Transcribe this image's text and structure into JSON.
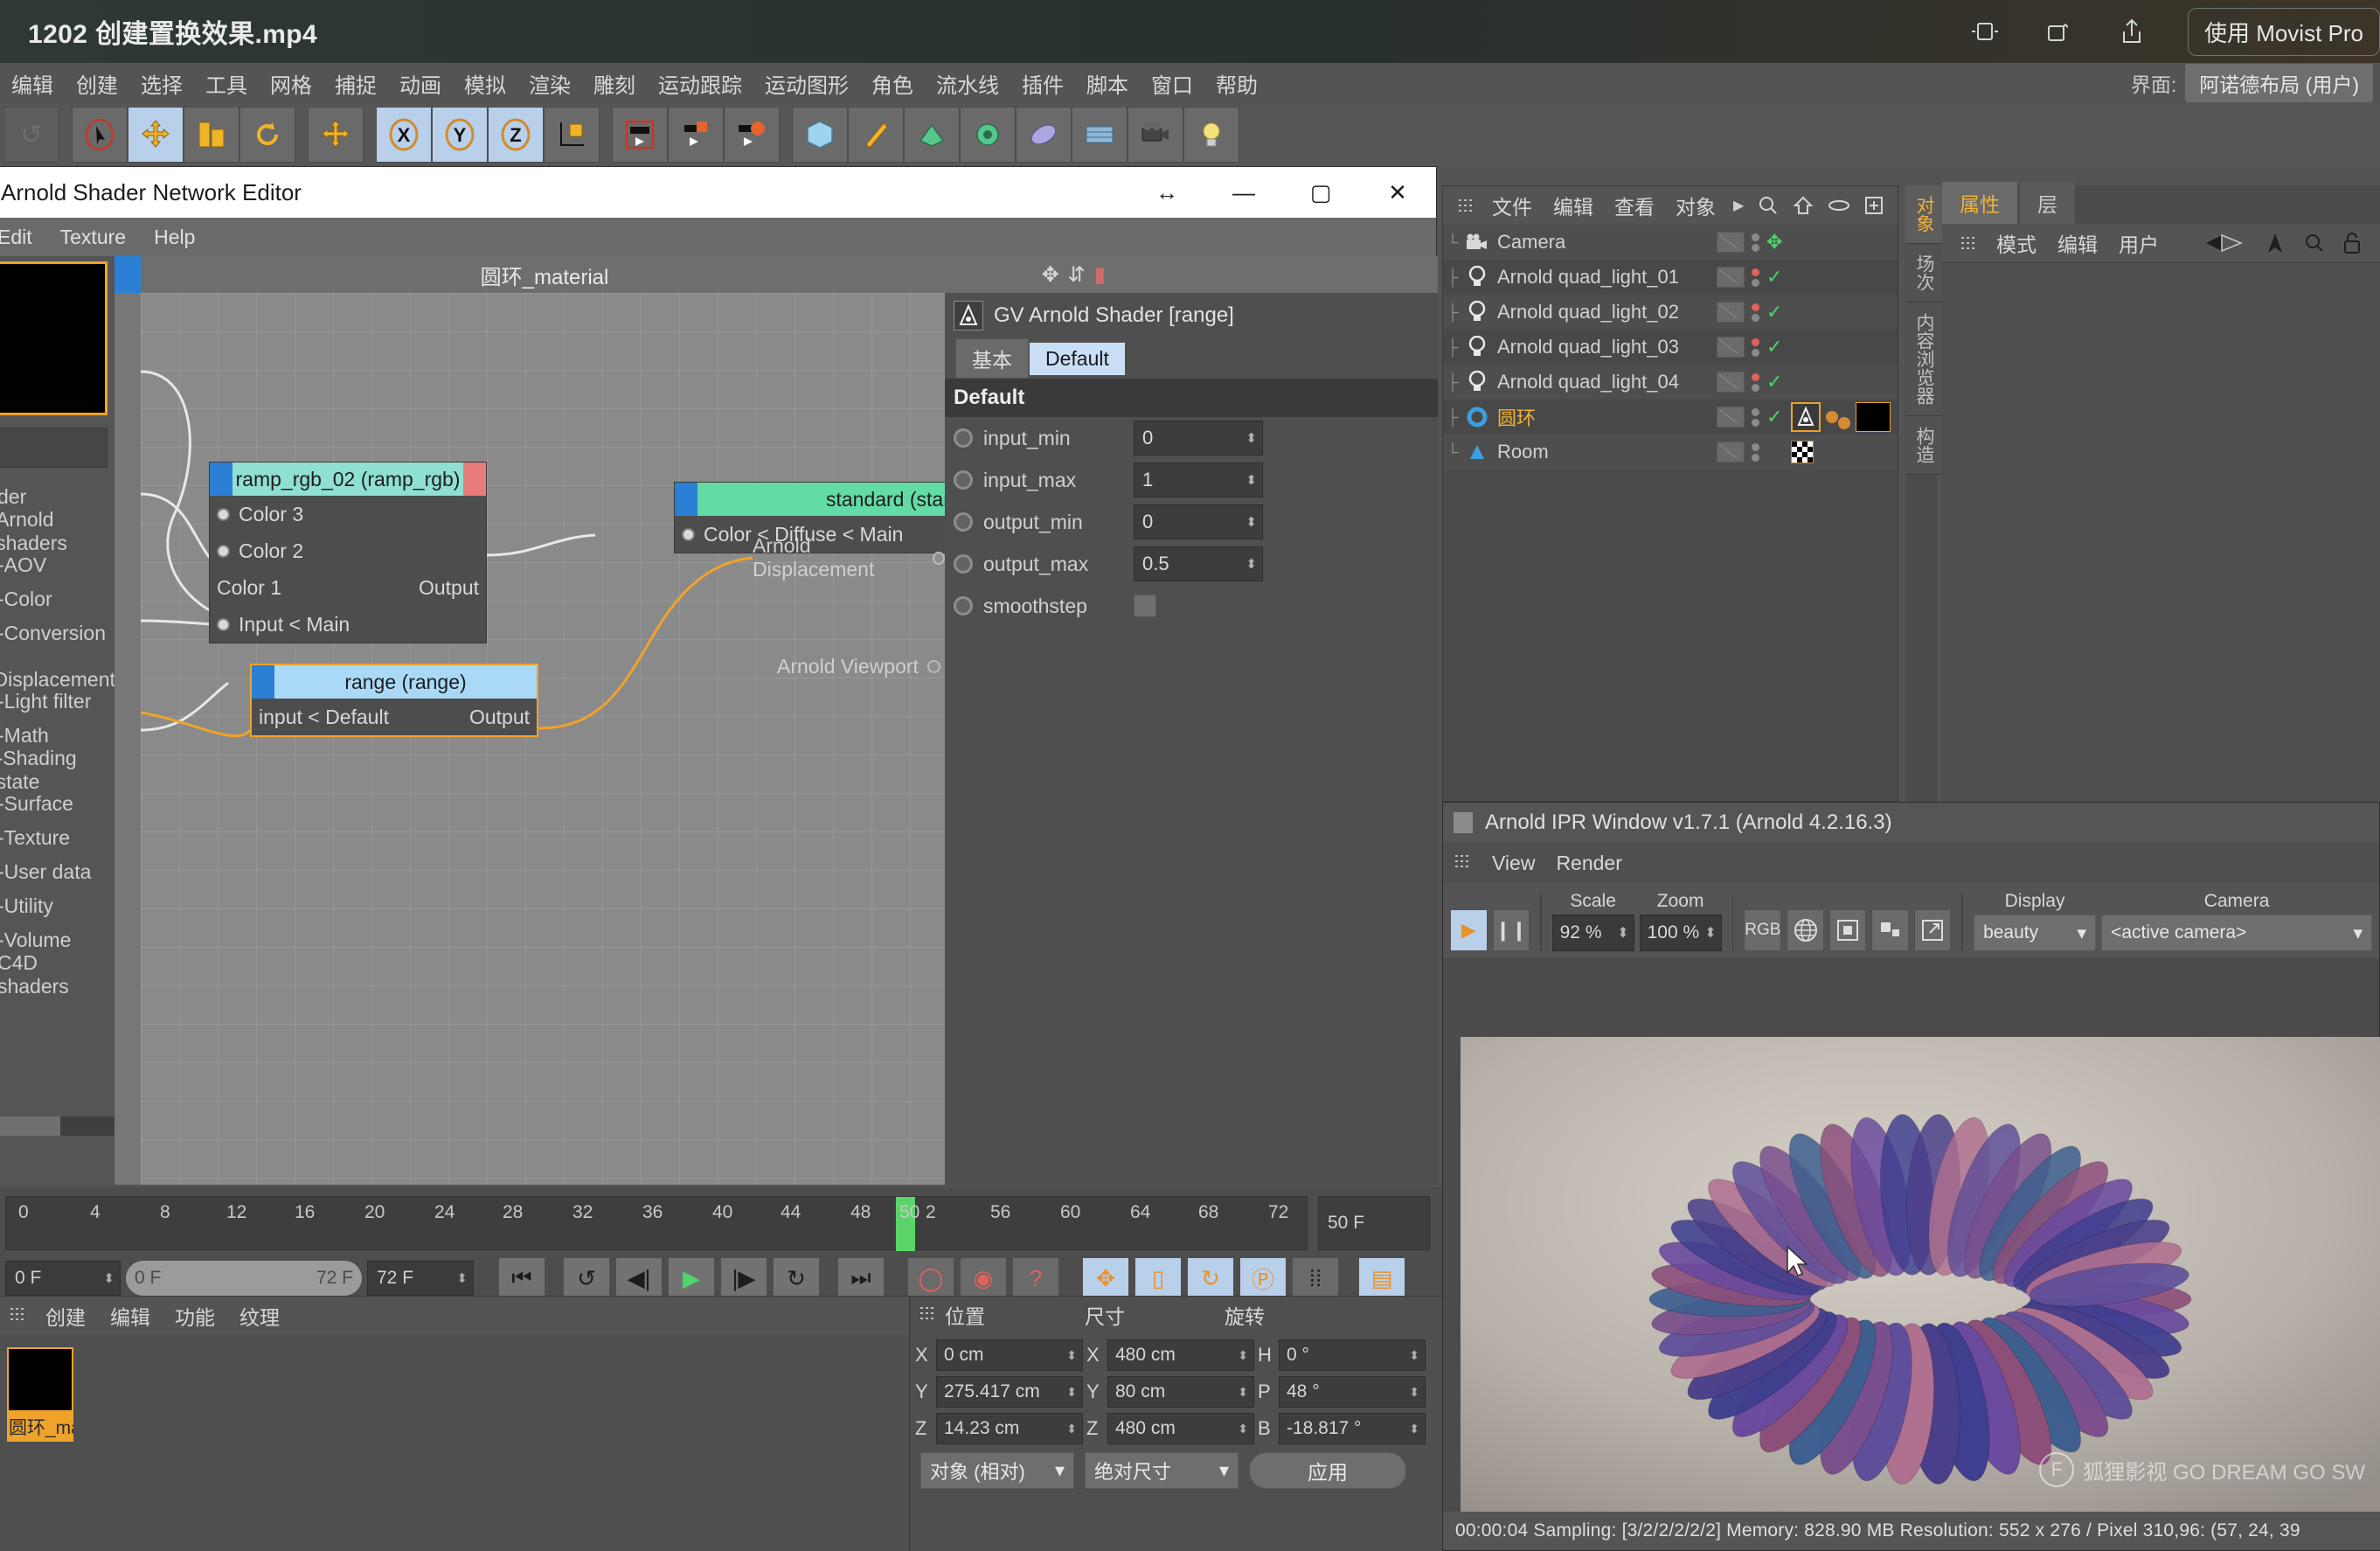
{
  "player": {
    "title": "1202 创建置换效果.mp4",
    "movist_label": "使用 Movist Pro",
    "icons": [
      "picture-in-picture-icon",
      "rotate-icon",
      "share-icon"
    ]
  },
  "menubar": {
    "items": [
      "编辑",
      "创建",
      "选择",
      "工具",
      "网格",
      "捕捉",
      "动画",
      "模拟",
      "渲染",
      "雕刻",
      "运动跟踪",
      "运动图形",
      "角色",
      "流水线",
      "插件",
      "脚本",
      "窗口",
      "帮助"
    ],
    "interface_label": "界面:",
    "interface_value": "阿诺德布局 (用户)"
  },
  "toolbar": {
    "groups": [
      {
        "buttons": [
          {
            "icon": "undo-icon",
            "state": "dim"
          }
        ]
      },
      {
        "buttons": [
          {
            "icon": "select-arrow-icon",
            "state": "normal"
          },
          {
            "icon": "move-icon",
            "state": "selected"
          },
          {
            "icon": "scale-icon",
            "state": "normal"
          },
          {
            "icon": "rotate-icon",
            "state": "normal"
          }
        ]
      },
      {
        "buttons": [
          {
            "icon": "move-axis-icon",
            "state": "normal"
          }
        ]
      },
      {
        "buttons": [
          {
            "icon": "axis-x-icon",
            "state": "selected"
          },
          {
            "icon": "axis-y-icon",
            "state": "selected"
          },
          {
            "icon": "axis-z-icon",
            "state": "selected"
          },
          {
            "icon": "world-axis-icon",
            "state": "normal"
          }
        ]
      },
      {
        "buttons": [
          {
            "icon": "render-view-icon",
            "state": "normal"
          },
          {
            "icon": "render-region-icon",
            "state": "normal"
          },
          {
            "icon": "render-settings-icon",
            "state": "normal"
          }
        ]
      },
      {
        "buttons": [
          {
            "icon": "cube-primitive-icon",
            "state": "normal"
          },
          {
            "icon": "spline-pen-icon",
            "state": "normal"
          },
          {
            "icon": "generator-icon",
            "state": "normal"
          },
          {
            "icon": "deformer-icon",
            "state": "normal"
          },
          {
            "icon": "environment-icon",
            "state": "normal"
          },
          {
            "icon": "scene-icon",
            "state": "normal"
          },
          {
            "icon": "camera-icon",
            "state": "normal"
          },
          {
            "icon": "light-icon",
            "state": "normal"
          }
        ]
      }
    ]
  },
  "object_manager": {
    "menu": [
      "文件",
      "编辑",
      "查看",
      "对象"
    ],
    "icons": [
      "more-arrow-icon",
      "search-icon",
      "home-icon",
      "eye-icon",
      "add-layer-icon"
    ],
    "rows": [
      {
        "name": "Camera",
        "icon": "camera-icon",
        "selected": false,
        "has_check": false,
        "dot": "grey",
        "tags": []
      },
      {
        "name": "Arnold quad_light_01",
        "icon": "light-icon",
        "selected": false,
        "has_check": true,
        "dot": "red",
        "tags": []
      },
      {
        "name": "Arnold quad_light_02",
        "icon": "light-icon",
        "selected": false,
        "has_check": true,
        "dot": "red",
        "tags": []
      },
      {
        "name": "Arnold quad_light_03",
        "icon": "light-icon",
        "selected": false,
        "has_check": true,
        "dot": "red",
        "tags": []
      },
      {
        "name": "Arnold quad_light_04",
        "icon": "light-icon",
        "selected": false,
        "has_check": true,
        "dot": "red",
        "tags": []
      },
      {
        "name": "圆环",
        "icon": "torus-icon",
        "selected": true,
        "has_check": true,
        "dot": "grey",
        "tags": [
          "arnold-tag",
          "material-tag"
        ]
      },
      {
        "name": "Room",
        "icon": "null-object-icon",
        "selected": false,
        "has_check": false,
        "dot": "grey",
        "tags": [
          "checker-tag"
        ]
      }
    ],
    "side_tabs": [
      "对象",
      "场次",
      "内容浏览器",
      "构造"
    ]
  },
  "attribute_manager": {
    "tabs": [
      {
        "label": "属性",
        "active": true
      },
      {
        "label": "层",
        "active": false
      }
    ],
    "menu": [
      "模式",
      "编辑",
      "用户"
    ],
    "icons": [
      "back-arrow-icon",
      "up-arrow-icon",
      "search-icon",
      "lock-icon"
    ]
  },
  "ipr": {
    "title": "Arnold IPR Window v1.7.1 (Arnold 4.2.16.3)",
    "menu": [
      "View",
      "Render"
    ],
    "controls": {
      "play": "play-icon",
      "pause": "pause-icon",
      "scale_label": "Scale",
      "scale_value": "92 %",
      "zoom_label": "Zoom",
      "zoom_value": "100 %",
      "channel_buttons": [
        "RGB",
        "globe-icon",
        "alpha-icon",
        "compare-icon",
        "popout-icon"
      ],
      "display_label": "Display",
      "display_value": "beauty",
      "camera_label": "Camera",
      "camera_value": "<active camera>"
    },
    "status": "00:00:04  Sampling: [3/2/2/2/2/2]  Memory: 828.90 MB  Resolution: 552 x 276 / Pixel 310,96: (57, 24, 39",
    "watermark": "狐狸影视  GO DREAM GO SW"
  },
  "shader_editor": {
    "window_title": "Arnold Shader Network Editor",
    "window_buttons": [
      "resize-icon",
      "minimize-icon",
      "maximize-icon",
      "close-icon"
    ],
    "menu": [
      "Edit",
      "Texture",
      "Help"
    ],
    "search_placeholder": "",
    "tree": [
      {
        "label": "der",
        "indent": 0,
        "arrow": false
      },
      {
        "label": "Arnold shaders",
        "indent": 0,
        "arrow": false
      },
      {
        "label": "-AOV",
        "indent": 1,
        "arrow": true
      },
      {
        "label": "-Color",
        "indent": 1,
        "arrow": true
      },
      {
        "label": "-Conversion",
        "indent": 1,
        "arrow": true
      },
      {
        "label": "-Displacement",
        "indent": 1,
        "arrow": true
      },
      {
        "label": "-Light filter",
        "indent": 1,
        "arrow": true
      },
      {
        "label": "-Math",
        "indent": 1,
        "arrow": true
      },
      {
        "label": "-Shading state",
        "indent": 1,
        "arrow": true
      },
      {
        "label": "-Surface",
        "indent": 1,
        "arrow": true
      },
      {
        "label": "-Texture",
        "indent": 1,
        "arrow": true
      },
      {
        "label": "-User data",
        "indent": 1,
        "arrow": true
      },
      {
        "label": "-Utility",
        "indent": 1,
        "arrow": true
      },
      {
        "label": "-Volume",
        "indent": 1,
        "arrow": true
      },
      {
        "label": "C4D shaders",
        "indent": 0,
        "arrow": false
      }
    ],
    "graph_title": "圆环_material",
    "graph_icons": [
      "move-nodes-icon",
      "collapse-icon"
    ],
    "nodes": [
      {
        "id": "ramp",
        "title": "ramp_rgb_02 (ramp_rgb)",
        "inputs": [
          "Color 3",
          "Color 2",
          "Color 1",
          "Input < Main"
        ],
        "outputs": [
          "Output"
        ]
      },
      {
        "id": "standard",
        "title": "standard (stan",
        "inputs": [
          "Color < Diffuse < Main"
        ],
        "outputs": []
      },
      {
        "id": "range",
        "title": "range (range)",
        "inputs": [
          "input < Default"
        ],
        "outputs": [
          "Output"
        ]
      }
    ],
    "floating_labels": [
      "Arnold Displacement",
      "Arnold Viewport"
    ],
    "properties": {
      "node_icon": "arnold-logo-icon",
      "header": "GV Arnold Shader [range]",
      "tabs": [
        {
          "label": "基本",
          "active": false
        },
        {
          "label": "Default",
          "active": true
        }
      ],
      "section": "Default",
      "fields": [
        {
          "label": "input_min",
          "value": "0",
          "type": "number"
        },
        {
          "label": "input_max",
          "value": "1",
          "type": "number"
        },
        {
          "label": "output_min",
          "value": "0",
          "type": "number"
        },
        {
          "label": "output_max",
          "value": "0.5",
          "type": "number"
        },
        {
          "label": "smoothstep",
          "value": "",
          "type": "checkbox"
        }
      ]
    }
  },
  "timeline": {
    "ticks": [
      "0",
      "4",
      "8",
      "12",
      "16",
      "20",
      "24",
      "28",
      "32",
      "36",
      "40",
      "44",
      "48",
      "50",
      "2",
      "56",
      "60",
      "64",
      "68",
      "72"
    ],
    "playhead_frame": "50",
    "end_field": "50 F",
    "current_frame": "0 F",
    "range_start": "0 F",
    "range_end": "72 F",
    "max_frame": "72 F",
    "transport": [
      "go-to-start-icon",
      "loop-back-icon",
      "step-back-icon",
      "play-icon",
      "step-forward-icon",
      "loop-forward-icon",
      "go-to-end-icon"
    ],
    "record_buttons": [
      "record-keyframe-icon",
      "autokey-icon",
      "keyframe-selection-icon"
    ],
    "key_buttons": [
      "position-key-icon",
      "scale-key-icon",
      "rotation-key-icon",
      "pla-key-icon",
      "point-level-icon"
    ],
    "extra_button": "timeline-mode-icon"
  },
  "material_manager": {
    "menu": [
      "创建",
      "编辑",
      "功能",
      "纹理"
    ],
    "materials": [
      {
        "name": "圆环_ma",
        "selected": true
      }
    ]
  },
  "coordinate_manager": {
    "headers": [
      "位置",
      "尺寸",
      "旋转"
    ],
    "rows": [
      {
        "pos_axis": "X",
        "pos_value": "0 cm",
        "size_axis": "X",
        "size_value": "480 cm",
        "rot_axis": "H",
        "rot_value": "0 °"
      },
      {
        "pos_axis": "Y",
        "pos_value": "275.417 cm",
        "size_axis": "Y",
        "size_value": "80 cm",
        "rot_axis": "P",
        "rot_value": "48 °"
      },
      {
        "pos_axis": "Z",
        "pos_value": "14.23 cm",
        "size_axis": "Z",
        "size_value": "480 cm",
        "rot_axis": "B",
        "rot_value": "-18.817 °"
      }
    ],
    "mode_dropdown": "对象 (相对)",
    "size_dropdown": "绝对尺寸",
    "apply_button": "应用"
  }
}
